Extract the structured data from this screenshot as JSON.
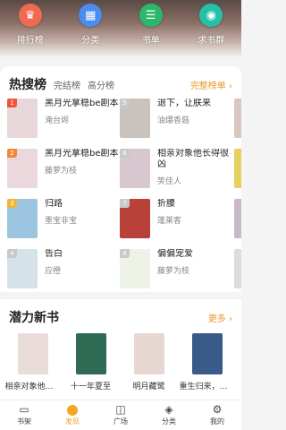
{
  "quick_nav": [
    {
      "label": "排行榜",
      "icon": "trophy-icon",
      "color": "#f06a4f",
      "glyph": "♛"
    },
    {
      "label": "分类",
      "icon": "grid-icon",
      "color": "#4a8cf0",
      "glyph": "▦"
    },
    {
      "label": "书单",
      "icon": "booklist-icon",
      "color": "#2cb86a",
      "glyph": "☰"
    },
    {
      "label": "求书群",
      "icon": "chat-icon",
      "color": "#22c1a8",
      "glyph": "◉"
    }
  ],
  "hot": {
    "title": "热搜榜",
    "tabs": [
      "完结榜",
      "高分榜"
    ],
    "more": "完整榜单 ›",
    "items": [
      {
        "rank": "1",
        "title": "黑月光拿稳be剧本",
        "author": "淹台烬",
        "badge_color": "#f0553a",
        "cover_color": "#e8d7d8"
      },
      {
        "rank": "5",
        "title": "退下，让朕来",
        "author": "油爆香菇",
        "badge_color": "#c9c9c9",
        "cover_color": "#c9c2bd"
      },
      {
        "rank": "2",
        "title": "黑月光拿稳be剧本",
        "author": "藤萝为枝",
        "badge_color": "#f08a3a",
        "cover_color": "#ead8dc"
      },
      {
        "rank": "6",
        "title": "相亲对象他长得很凶",
        "author": "笑佳人",
        "badge_color": "#c9c9c9",
        "cover_color": "#d8c7ce"
      },
      {
        "rank": "3",
        "title": "归路",
        "author": "墨宝非宝",
        "badge_color": "#f2b43a",
        "cover_color": "#9cc6e0"
      },
      {
        "rank": "7",
        "title": "折腰",
        "author": "蓬莱客",
        "badge_color": "#c9c9c9",
        "cover_color": "#b8423a"
      },
      {
        "rank": "4",
        "title": "告白",
        "author": "应橙",
        "badge_color": "#c9c9c9",
        "cover_color": "#d6e2ea"
      },
      {
        "rank": "8",
        "title": "偏偏宠爱",
        "author": "藤萝为枝",
        "badge_color": "#c9c9c9",
        "cover_color": "#eef3e8"
      }
    ],
    "edge_colors": [
      "#d8c8c0",
      "#e8d060",
      "#c8b8c8",
      "#dddddd"
    ]
  },
  "potential": {
    "title": "潜力新书",
    "more": "更多 ›",
    "books": [
      {
        "name": "相亲对象他长...",
        "cover_color": "#eadcd8"
      },
      {
        "name": "十一年夏至",
        "cover_color": "#2f6a55"
      },
      {
        "name": "明月藏鹭",
        "cover_color": "#e6d7d0"
      },
      {
        "name": "重生归来，家...",
        "cover_color": "#3a5a8a"
      }
    ]
  },
  "tabbar": [
    {
      "label": "书架",
      "glyph": "▭",
      "icon": "bookshelf-icon"
    },
    {
      "label": "发现",
      "glyph": "◎",
      "icon": "discover-icon"
    },
    {
      "label": "广场",
      "glyph": "◫",
      "icon": "square-icon"
    },
    {
      "label": "分类",
      "glyph": "◈",
      "icon": "category-icon"
    },
    {
      "label": "我的",
      "glyph": "⚙",
      "icon": "profile-gear-icon"
    }
  ],
  "active_tab": "发现",
  "accent_color": "#f0a02a"
}
